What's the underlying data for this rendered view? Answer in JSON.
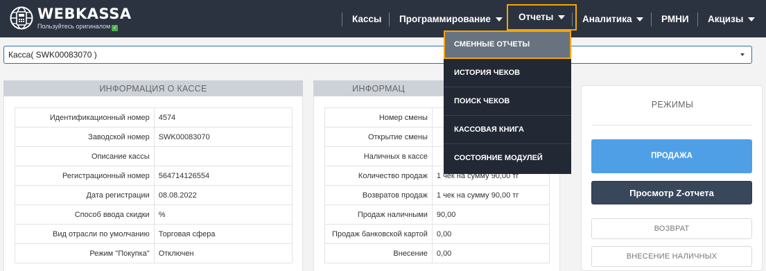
{
  "brand": {
    "name": "WEBKASSA",
    "tagline": "Пользуйтесь оригиналом"
  },
  "nav": {
    "items": [
      {
        "label": "Кассы",
        "has_caret": false
      },
      {
        "label": "Программирование",
        "has_caret": true
      },
      {
        "label": "Отчеты",
        "has_caret": true,
        "active": true
      },
      {
        "label": "Аналитика",
        "has_caret": true
      },
      {
        "label": "РМНИ",
        "has_caret": false
      },
      {
        "label": "Акцизы",
        "has_caret": true
      }
    ]
  },
  "kassa_select": {
    "value": "Касса( SWK00083070 )"
  },
  "reports_menu": {
    "items": [
      "СМЕННЫЕ ОТЧЕТЫ",
      "ИСТОРИЯ ЧЕКОВ",
      "ПОИСК ЧЕКОВ",
      "КАССОВАЯ КНИГА",
      "СОСТОЯНИЕ МОДУЛЕЙ"
    ],
    "highlighted": 0
  },
  "kassa_info": {
    "title": "ИНФОРМАЦИЯ О КАССЕ",
    "rows": [
      {
        "label": "Идентификационный номер",
        "value": "4574"
      },
      {
        "label": "Заводской номер",
        "value": "SWK00083070"
      },
      {
        "label": "Описание кассы",
        "value": ""
      },
      {
        "label": "Регистрационный номер",
        "value": "564714126554"
      },
      {
        "label": "Дата регистрации",
        "value": "08.08.2022"
      },
      {
        "label": "Способ ввода скидки",
        "value": "%"
      },
      {
        "label": "Вид отрасли по умолчанию",
        "value": "Торговая сфера"
      },
      {
        "label": "Режим \"Покупка\"",
        "value": "Отключен"
      }
    ]
  },
  "shift_info": {
    "title": "ИНФОРМАЦ",
    "rows": [
      {
        "label": "Номер смены",
        "value": ""
      },
      {
        "label": "Открытие смены",
        "value": ""
      },
      {
        "label": "Наличных в кассе",
        "value": ""
      },
      {
        "label": "Количество продаж",
        "value": "1 чек на сумму 90,00 тг"
      },
      {
        "label": "Возвратов продаж",
        "value": "1 чек на сумму 90,00 тг"
      },
      {
        "label": "Продаж наличными",
        "value": "90,00"
      },
      {
        "label": "Продаж банковской картой",
        "value": "0,00"
      },
      {
        "label": "Внесение",
        "value": "0,00"
      }
    ]
  },
  "modes": {
    "title": "РЕЖИМЫ",
    "sale_button": "ПРОДАЖА",
    "z_report_button": "Просмотр Z-отчета",
    "return_button": "ВОЗВРАТ",
    "cash_in_button": "ВНЕСЕНИЕ НАЛИЧНЫХ"
  },
  "colors": {
    "navbar": "#2c3340",
    "accent_outline": "#f7a600",
    "sale_button": "#4f9fe6",
    "z_button": "#39475a",
    "dropdown": "#222834"
  }
}
